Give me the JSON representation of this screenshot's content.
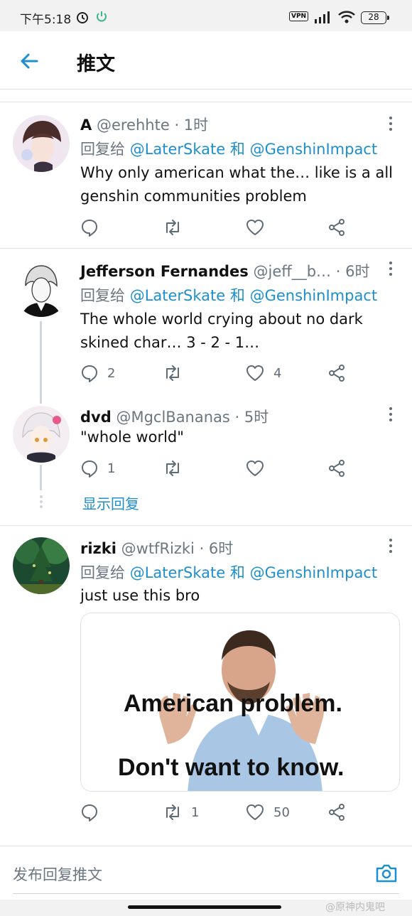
{
  "status_bar": {
    "time": "下午5:18",
    "vpn": "VPN",
    "battery": "28"
  },
  "header": {
    "title": "推文"
  },
  "tweets": [
    {
      "name": "A",
      "handle": "@erehhte",
      "time": "· 1时",
      "reply_prefix": "回复给 ",
      "mention1": "@LaterSkate",
      "joiner": " 和 ",
      "mention2": "@GenshinImpact",
      "text": "Why only american what the… like is a all genshin communities problem",
      "replies": "",
      "retweets": "",
      "likes": ""
    },
    {
      "name": "Jefferson Fernandes",
      "handle": "@jeff__b…",
      "time": "· 6时",
      "reply_prefix": "回复给 ",
      "mention1": "@LaterSkate",
      "joiner": " 和 ",
      "mention2": "@GenshinImpact",
      "text": "The whole world crying about no dark skined char… 3 - 2 - 1…",
      "replies": "2",
      "retweets": "",
      "likes": "4"
    },
    {
      "name": "dvd",
      "handle": "@MgclBananas",
      "time": "· 5时",
      "text": "\"whole world\"",
      "replies": "1",
      "retweets": "",
      "likes": ""
    },
    {
      "name": "rizki",
      "handle": "@wtfRizki",
      "time": "· 6时",
      "reply_prefix": "回复给 ",
      "mention1": "@LaterSkate",
      "joiner": " 和 ",
      "mention2": "@GenshinImpact",
      "text": "just use this bro",
      "media_line1": "American problem.",
      "media_line2": "Don't want to know.",
      "replies": "",
      "retweets": "1",
      "likes": "50"
    }
  ],
  "show_replies": "显示回复",
  "composer": {
    "placeholder": "发布回复推文"
  },
  "watermark": "@原神内鬼吧",
  "colors": {
    "accent": "#1d8fcf",
    "muted": "#6b7680",
    "divider": "#e2e2e2"
  },
  "icons": [
    "back-arrow-icon",
    "more-icon",
    "reply-icon",
    "retweet-icon",
    "like-icon",
    "share-icon",
    "camera-icon"
  ]
}
